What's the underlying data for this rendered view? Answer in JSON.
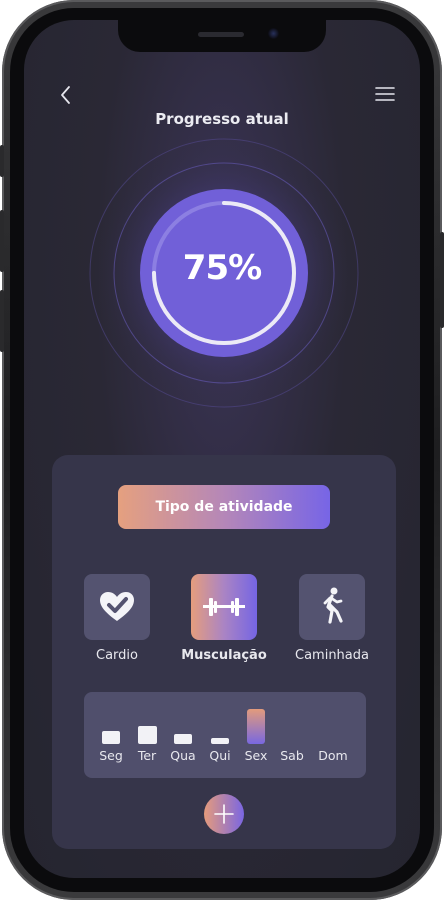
{
  "header": {
    "back_icon": "chevron-left-icon",
    "menu_icon": "hamburger-menu-icon",
    "title": "Progresso atual"
  },
  "progress": {
    "value": 0.75,
    "label": "75%"
  },
  "activity": {
    "type_button_label": "Tipo de atividade",
    "items": [
      {
        "label": "Cardio",
        "icon": "heart-check-icon",
        "selected": false
      },
      {
        "label": "Musculação",
        "icon": "dumbbell-icon",
        "selected": true
      },
      {
        "label": "Caminhada",
        "icon": "walking-person-icon",
        "selected": false
      }
    ]
  },
  "week": {
    "days": [
      {
        "label": "Seg",
        "level": 0.45
      },
      {
        "label": "Ter",
        "level": 0.65
      },
      {
        "label": "Qua",
        "level": 0.35
      },
      {
        "label": "Qui",
        "level": 0.2
      },
      {
        "label": "Sex",
        "level": 0.9,
        "selected": true
      },
      {
        "label": "Sab",
        "level": 0
      },
      {
        "label": "Dom",
        "level": 0
      }
    ]
  },
  "add_button": {
    "icon": "plus-icon"
  },
  "colors": {
    "background": "#2a2835",
    "card": "#36354a",
    "accent_purple": "#7565e3",
    "accent_orange": "#e59d7d",
    "circle_fill": "#7160d8"
  }
}
